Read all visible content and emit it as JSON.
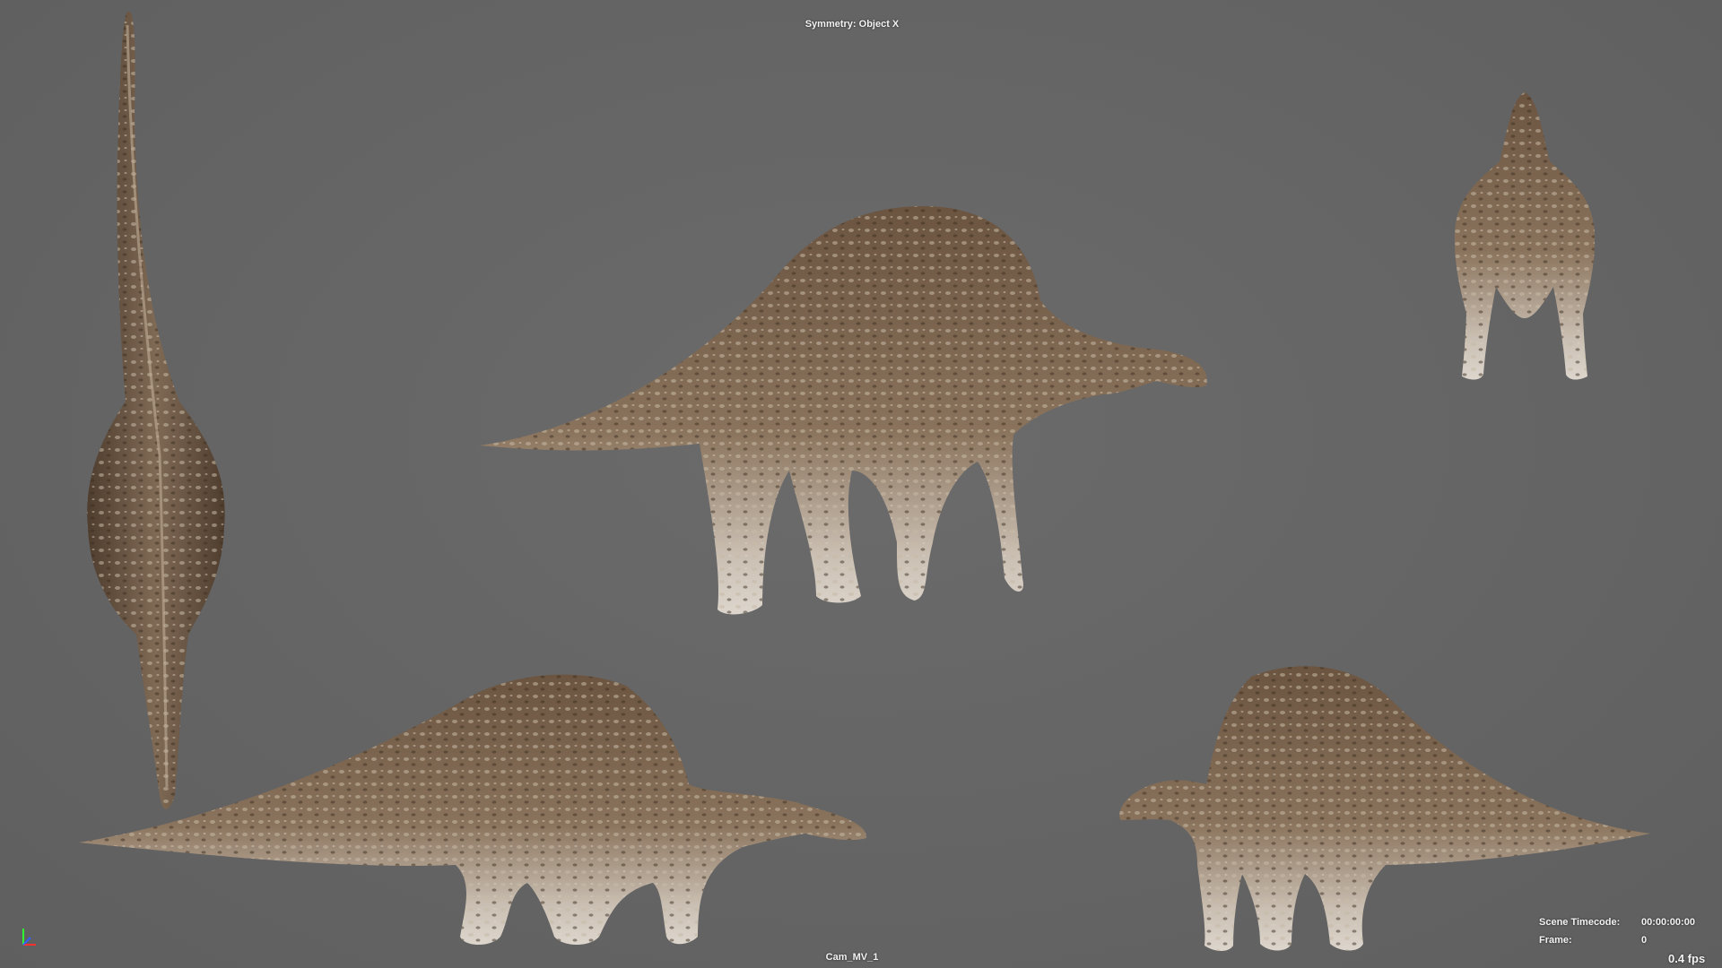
{
  "hud": {
    "symmetry": "Symmetry: Object X",
    "camera": "Cam_MV_1",
    "timecode_label": "Scene Timecode:",
    "timecode_value": "00:00:00:00",
    "frame_label": "Frame:",
    "frame_value": "0",
    "fps": "0.4 fps"
  },
  "colors": {
    "background": "#666666",
    "skin_dark": "#5a4634",
    "skin_mid": "#7d6650",
    "skin_light": "#b8ab9c",
    "belly": "#d8d2cb"
  },
  "views": [
    "top",
    "perspective",
    "front",
    "left-side",
    "right-side"
  ],
  "gizmo": {
    "axes": [
      "x",
      "y",
      "z"
    ],
    "colors": [
      "#ff3030",
      "#30ff30",
      "#3060ff"
    ]
  }
}
